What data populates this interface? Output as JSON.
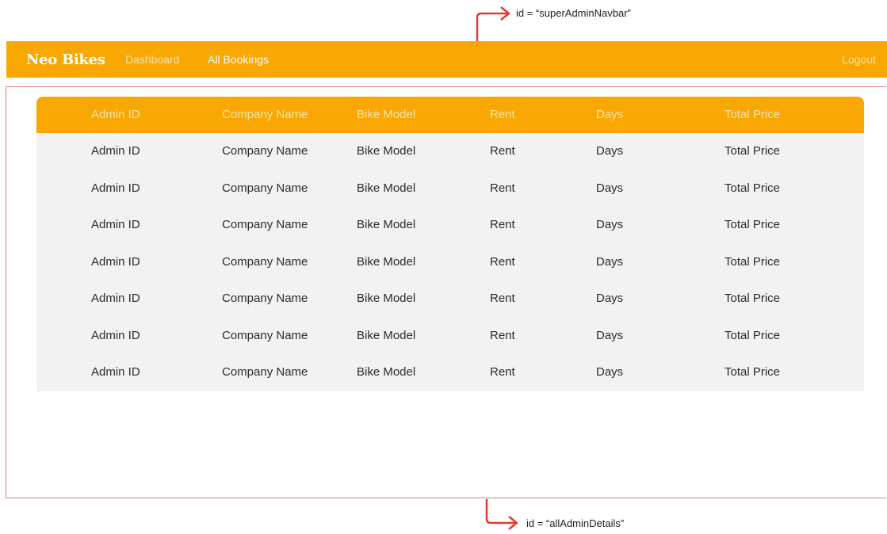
{
  "annotations": {
    "navbar_id": "id = “superAdminNavbar”",
    "details_id": "id = “allAdminDetails”",
    "arrow_color": "#e53935"
  },
  "navbar": {
    "brand": "Neo Bikes",
    "links": {
      "dashboard": "Dashboard",
      "all_bookings": "All Bookings"
    },
    "logout": "Logout",
    "background": "#f9a703"
  },
  "table": {
    "headers": [
      "Admin ID",
      "Company Name",
      "Bike Model",
      "Rent",
      "Days",
      "Total Price"
    ],
    "rows": [
      [
        "Admin ID",
        "Company Name",
        "Bike Model",
        "Rent",
        "Days",
        "Total Price"
      ],
      [
        "Admin ID",
        "Company Name",
        "Bike Model",
        "Rent",
        "Days",
        "Total Price"
      ],
      [
        "Admin ID",
        "Company Name",
        "Bike Model",
        "Rent",
        "Days",
        "Total Price"
      ],
      [
        "Admin ID",
        "Company Name",
        "Bike Model",
        "Rent",
        "Days",
        "Total Price"
      ],
      [
        "Admin ID",
        "Company Name",
        "Bike Model",
        "Rent",
        "Days",
        "Total Price"
      ],
      [
        "Admin ID",
        "Company Name",
        "Bike Model",
        "Rent",
        "Days",
        "Total Price"
      ],
      [
        "Admin ID",
        "Company Name",
        "Bike Model",
        "Rent",
        "Days",
        "Total Price"
      ]
    ]
  }
}
